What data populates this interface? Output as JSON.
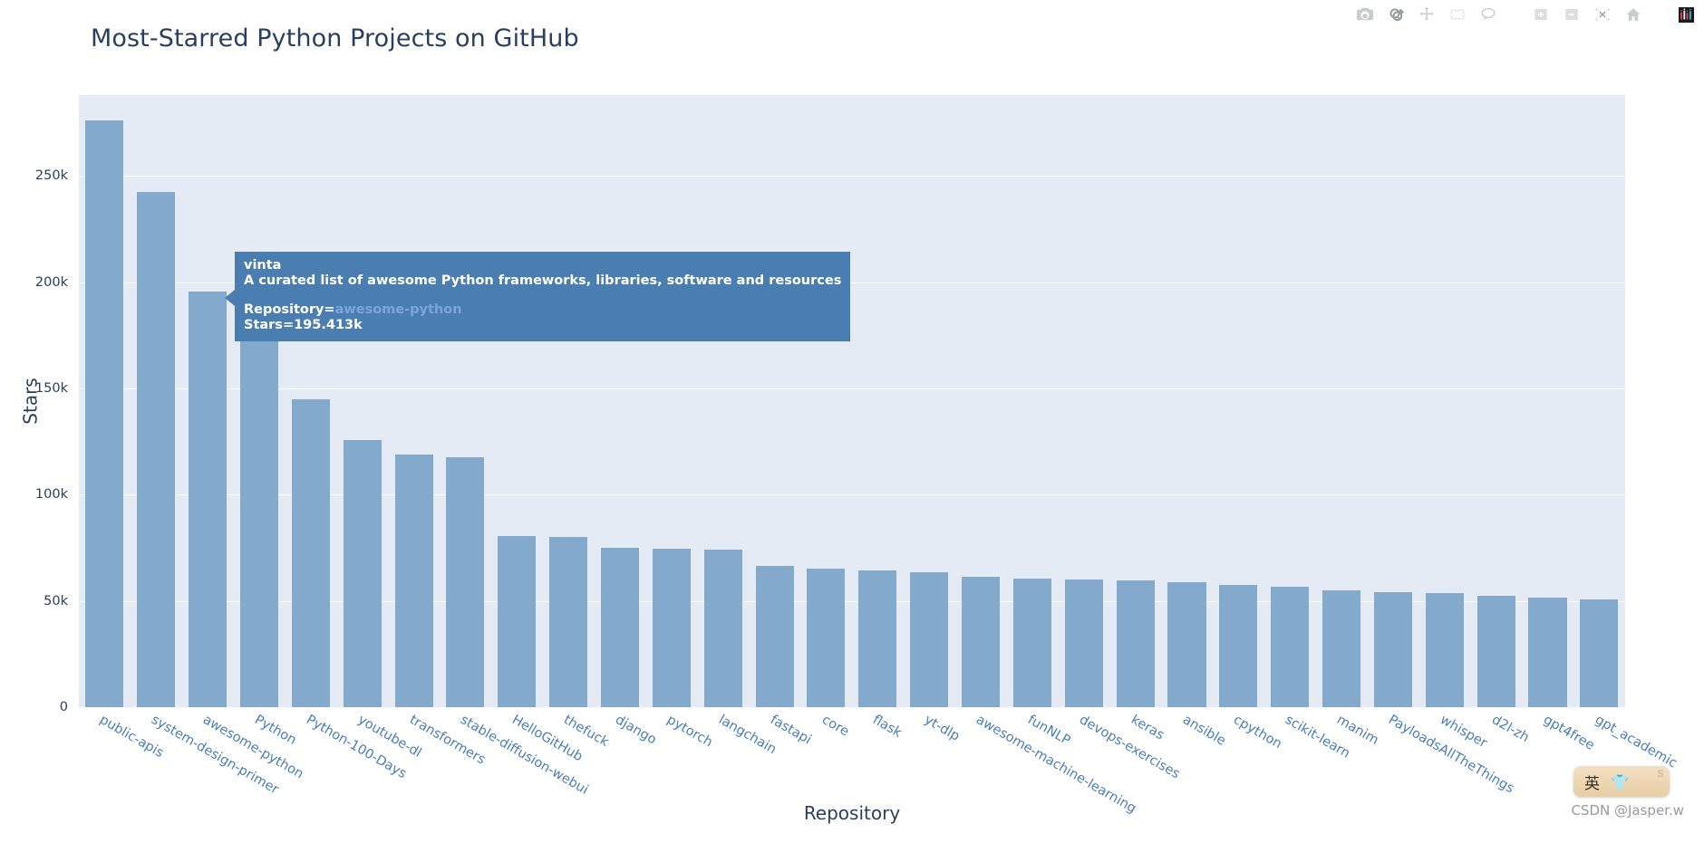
{
  "chart_data": {
    "type": "bar",
    "title": "Most-Starred Python Projects on GitHub",
    "xlabel": "Repository",
    "ylabel": "Stars",
    "ylim": [
      0,
      288000
    ],
    "grid": true,
    "legend": "none",
    "ytick_labels": [
      "0",
      "50k",
      "100k",
      "150k",
      "200k",
      "250k"
    ],
    "ytick_values": [
      0,
      50000,
      100000,
      150000,
      200000,
      250000
    ],
    "categories": [
      "public-apis",
      "system-design-primer",
      "awesome-python",
      "Python",
      "Python-100-Days",
      "youtube-dl",
      "transformers",
      "stable-diffusion-webui",
      "HelloGitHub",
      "thefuck",
      "django",
      "pytorch",
      "langchain",
      "fastapi",
      "core",
      "flask",
      "yt-dlp",
      "awesome-machine-learning",
      "funNLP",
      "devops-exercises",
      "keras",
      "ansible",
      "cpython",
      "scikit-learn",
      "manim",
      "PayloadsAllTheThings",
      "whisper",
      "d2l-zh",
      "gpt4free",
      "gpt_academic"
    ],
    "values": [
      276000,
      242500,
      195413,
      173500,
      145000,
      125500,
      119000,
      117500,
      80500,
      80000,
      75000,
      74500,
      74000,
      66500,
      65000,
      64500,
      63500,
      61500,
      60500,
      60000,
      59500,
      59000,
      57500,
      56500,
      55000,
      54000,
      53500,
      52500,
      51500,
      50500
    ]
  },
  "tooltip": {
    "owner": "vinta",
    "description": "A curated list of awesome Python frameworks, libraries, software and resources",
    "repo_label": "Repository=",
    "repo_value": "awesome-python",
    "stars_line": "Stars=195.413k"
  },
  "modebar": {
    "buttons": [
      {
        "name": "download-camera-icon",
        "title": "Download plot as a png"
      },
      {
        "name": "zoom-icon",
        "title": "Zoom"
      },
      {
        "name": "pan-icon",
        "title": "Pan"
      },
      {
        "name": "box-select-icon",
        "title": "Box Select"
      },
      {
        "name": "lasso-select-icon",
        "title": "Lasso Select"
      },
      {
        "name": "zoom-in-icon",
        "title": "Zoom in"
      },
      {
        "name": "zoom-out-icon",
        "title": "Zoom out"
      },
      {
        "name": "autoscale-icon",
        "title": "Autoscale"
      },
      {
        "name": "reset-axes-home-icon",
        "title": "Reset axes"
      },
      {
        "name": "plotly-logo-icon",
        "title": "Produced with Plotly"
      }
    ]
  },
  "ime": {
    "language": "英",
    "tray_glyph": "👕",
    "brand": "S"
  },
  "watermark": {
    "text": "CSDN @Jasper.w"
  },
  "colors": {
    "bar": "#83a9cd",
    "plot_bg": "#e5ebf4",
    "paper_bg": "#ffffff",
    "axis_text": "#2a3f5f",
    "tick_text": "#4a7ebb",
    "tooltip_bg": "#4a7eb0",
    "tooltip_link": "#7ba6d8",
    "gridline": "#ffffff"
  }
}
